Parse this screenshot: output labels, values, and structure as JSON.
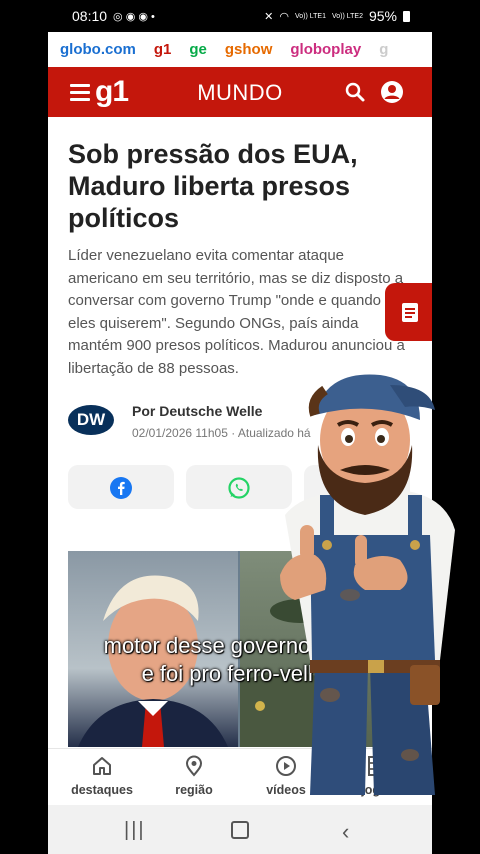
{
  "status_bar": {
    "time": "08:10",
    "battery": "95%",
    "network_1": "Vo)) LTE1",
    "network_2": "Vo)) LTE2"
  },
  "portals": [
    "globo.com",
    "g1",
    "ge",
    "gshow",
    "globoplay",
    "g"
  ],
  "header": {
    "logo": "g1",
    "section": "MUNDO"
  },
  "article": {
    "title": "Sob pressão dos EUA, Maduro liberta presos políticos",
    "subtitle": "Líder venezuelano evita comentar ataque americano em seu território, mas se diz disposto a conversar com governo Trump \"onde e quando eles quiserem\". Segundo ONGs, país ainda mantém 900 presos políticos. Madurou anunciou a libertação de 88 pessoas.",
    "author_logo": "DW",
    "author": "Por Deutsche Welle",
    "date": "02/01/2026 11h05 · Atualizado há"
  },
  "caption": {
    "line1": "motor desse governo fundiu",
    "line2": "e foi pro ferro-velho."
  },
  "tabs": [
    {
      "label": "destaques",
      "icon": "home-icon"
    },
    {
      "label": "região",
      "icon": "location-pin-icon"
    },
    {
      "label": "vídeos",
      "icon": "play-circle-icon"
    },
    {
      "label": "jogos",
      "icon": "grid-icon"
    }
  ],
  "colors": {
    "g1_red": "#c4170c",
    "facebook_blue": "#1877f2",
    "whatsapp_green": "#25d366"
  }
}
